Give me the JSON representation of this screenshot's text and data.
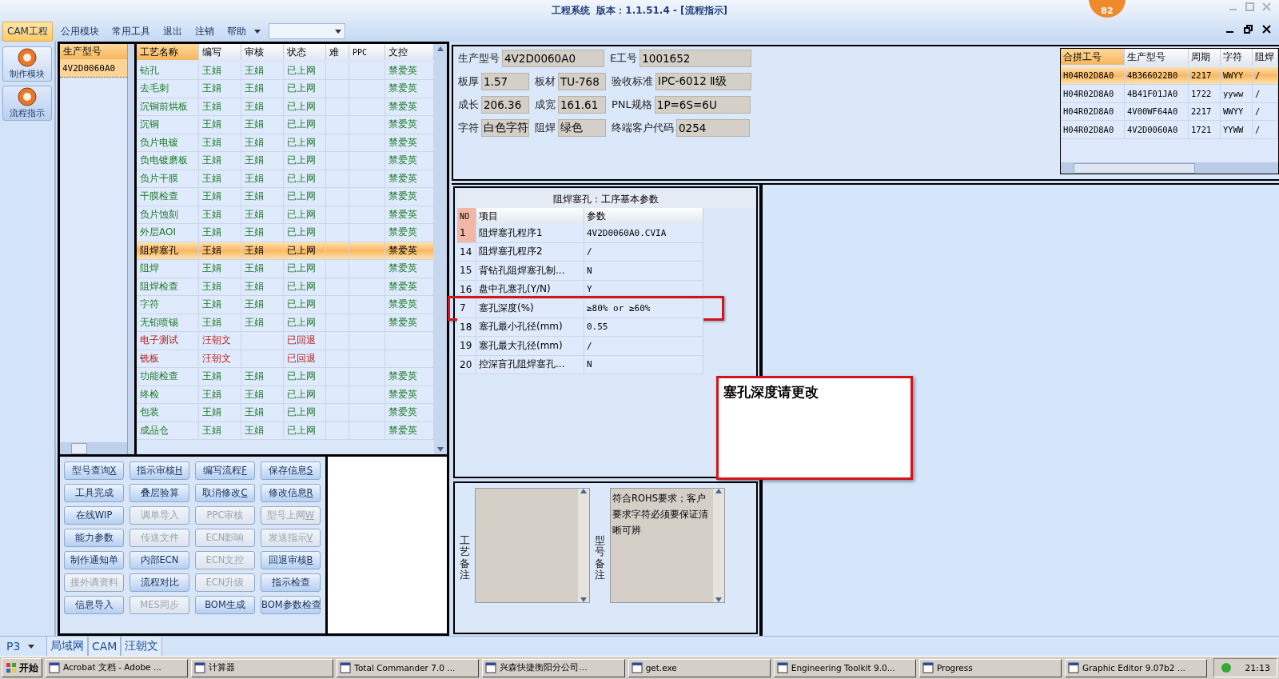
{
  "title_bar": {
    "title": "工程系统  版本：1.1.51.4 - [流程指示]",
    "badge": "82"
  },
  "menu": {
    "items": [
      {
        "label": "CAM工程",
        "selected": true
      },
      {
        "label": "公用模块",
        "selected": false
      },
      {
        "label": "常用工具",
        "selected": false
      },
      {
        "label": "退出",
        "selected": false
      },
      {
        "label": "注销",
        "selected": false
      },
      {
        "label": "帮助",
        "selected": false
      }
    ]
  },
  "nav": [
    {
      "label": "制作模块",
      "selected": false
    },
    {
      "label": "流程指示",
      "selected": true
    }
  ],
  "models": {
    "header": "生产型号",
    "rows": [
      {
        "text": "4V2D0060A0",
        "selected": true
      }
    ]
  },
  "process_table": {
    "columns": [
      "工艺名称",
      "编写",
      "审核",
      "状态",
      "难",
      "PPC",
      "文控"
    ],
    "rows": [
      {
        "cells": [
          "钻孔",
          "王娟",
          "王娟",
          "已上网",
          "",
          "",
          "禁爱英"
        ],
        "kind": "online",
        "selected": false
      },
      {
        "cells": [
          "去毛刺",
          "王娟",
          "王娟",
          "已上网",
          "",
          "",
          "禁爱英"
        ],
        "kind": "online",
        "selected": false
      },
      {
        "cells": [
          "沉铜前烘板",
          "王娟",
          "王娟",
          "已上网",
          "",
          "",
          "禁爱英"
        ],
        "kind": "online",
        "selected": false
      },
      {
        "cells": [
          "沉铜",
          "王娟",
          "王娟",
          "已上网",
          "",
          "",
          "禁爱英"
        ],
        "kind": "online",
        "selected": false
      },
      {
        "cells": [
          "负片电镀",
          "王娟",
          "王娟",
          "已上网",
          "",
          "",
          "禁爱英"
        ],
        "kind": "online",
        "selected": false
      },
      {
        "cells": [
          "负电镀磨板",
          "王娟",
          "王娟",
          "已上网",
          "",
          "",
          "禁爱英"
        ],
        "kind": "online",
        "selected": false
      },
      {
        "cells": [
          "负片干膜",
          "王娟",
          "王娟",
          "已上网",
          "",
          "",
          "禁爱英"
        ],
        "kind": "online",
        "selected": false
      },
      {
        "cells": [
          "干膜检查",
          "王娟",
          "王娟",
          "已上网",
          "",
          "",
          "禁爱英"
        ],
        "kind": "online",
        "selected": false
      },
      {
        "cells": [
          "负片蚀刻",
          "王娟",
          "王娟",
          "已上网",
          "",
          "",
          "禁爱英"
        ],
        "kind": "online",
        "selected": false
      },
      {
        "cells": [
          "外层AOI",
          "王娟",
          "王娟",
          "已上网",
          "",
          "",
          "禁爱英"
        ],
        "kind": "online",
        "selected": false
      },
      {
        "cells": [
          "阻焊塞孔",
          "王娟",
          "王娟",
          "已上网",
          "",
          "",
          "禁爱英"
        ],
        "kind": "online",
        "selected": true
      },
      {
        "cells": [
          "阻焊",
          "王娟",
          "王娟",
          "已上网",
          "",
          "",
          "禁爱英"
        ],
        "kind": "online",
        "selected": false
      },
      {
        "cells": [
          "阻焊检查",
          "王娟",
          "王娟",
          "已上网",
          "",
          "",
          "禁爱英"
        ],
        "kind": "online",
        "selected": false
      },
      {
        "cells": [
          "字符",
          "王娟",
          "王娟",
          "已上网",
          "",
          "",
          "禁爱英"
        ],
        "kind": "online",
        "selected": false
      },
      {
        "cells": [
          "无铅喷锡",
          "王娟",
          "王娟",
          "已上网",
          "",
          "",
          "禁爱英"
        ],
        "kind": "online",
        "selected": false
      },
      {
        "cells": [
          "电子测试",
          "汪朝文",
          "",
          "已回退",
          "",
          "",
          ""
        ],
        "kind": "returned",
        "selected": false
      },
      {
        "cells": [
          "铣板",
          "汪朝文",
          "",
          "已回退",
          "",
          "",
          ""
        ],
        "kind": "returned",
        "selected": false
      },
      {
        "cells": [
          "功能检查",
          "王娟",
          "王娟",
          "已上网",
          "",
          "",
          "禁爱英"
        ],
        "kind": "online",
        "selected": false
      },
      {
        "cells": [
          "终检",
          "王娟",
          "王娟",
          "已上网",
          "",
          "",
          "禁爱英"
        ],
        "kind": "online",
        "selected": false
      },
      {
        "cells": [
          "包装",
          "王娟",
          "王娟",
          "已上网",
          "",
          "",
          "禁爱英"
        ],
        "kind": "online",
        "selected": false
      },
      {
        "cells": [
          "成品仓",
          "王娟",
          "王娟",
          "已上网",
          "",
          "",
          "禁爱英"
        ],
        "kind": "online",
        "selected": false
      }
    ]
  },
  "actions": [
    {
      "label": "型号查询",
      "hotkey": "X",
      "disabled": false
    },
    {
      "label": "指示审核",
      "hotkey": "H",
      "disabled": false
    },
    {
      "label": "编写流程",
      "hotkey": "F",
      "disabled": false
    },
    {
      "label": "保存信息",
      "hotkey": "S",
      "disabled": false
    },
    {
      "label": "工具完成",
      "disabled": false
    },
    {
      "label": "叠层验算",
      "disabled": false
    },
    {
      "label": "取消修改",
      "hotkey": "C",
      "disabled": false
    },
    {
      "label": "修改信息",
      "hotkey": "R",
      "disabled": false
    },
    {
      "label": "在线WIP",
      "disabled": false
    },
    {
      "label": "调单导入",
      "disabled": true
    },
    {
      "label": "PPC审核",
      "disabled": true
    },
    {
      "label": "型号上网",
      "hotkey": "W",
      "disabled": true
    },
    {
      "label": "能力参数",
      "disabled": false
    },
    {
      "label": "传送文件",
      "disabled": true
    },
    {
      "label": "ECN影响",
      "disabled": true
    },
    {
      "label": "发送指示",
      "hotkey": "V",
      "disabled": true
    },
    {
      "label": "制作通知单",
      "disabled": false
    },
    {
      "label": "内部ECN",
      "disabled": false
    },
    {
      "label": "ECN文控",
      "disabled": true
    },
    {
      "label": "回退审核",
      "hotkey": "B",
      "disabled": false
    },
    {
      "label": "接外调资料",
      "disabled": true
    },
    {
      "label": "流程对比",
      "disabled": false
    },
    {
      "label": "ECN升级",
      "disabled": true
    },
    {
      "label": "指示检查",
      "disabled": false
    },
    {
      "label": "信息导入",
      "disabled": false
    },
    {
      "label": "MES同步",
      "disabled": true
    },
    {
      "label": "BOM生成",
      "disabled": false
    },
    {
      "label": "BOM参数检查",
      "disabled": false
    }
  ],
  "info": [
    [
      {
        "label": "生产型号",
        "value": "4V2D0060A0"
      },
      {
        "label": "E工号",
        "value": "1001652"
      }
    ],
    [
      {
        "label": "板厚",
        "value": "1.57"
      },
      {
        "label": "板材",
        "value": "TU-768"
      },
      {
        "label": "验收标准",
        "value": "IPC-6012 Ⅱ级"
      }
    ],
    [
      {
        "label": "成长",
        "value": "206.36"
      },
      {
        "label": "成宽",
        "value": "161.61"
      },
      {
        "label": "PNL规格",
        "value": "1P=6S=6U"
      }
    ],
    [
      {
        "label": "字符",
        "value": "白色字符"
      },
      {
        "label": "阻焊",
        "value": "绿色"
      },
      {
        "label": "终端客户代码",
        "value": "0254"
      }
    ]
  ],
  "merge_table": {
    "columns": [
      "合拼工号",
      "生产型号",
      "周期",
      "字符",
      "阻焊"
    ],
    "rows": [
      {
        "cells": [
          "H04R02D8A0",
          "4B366022B0",
          "2217",
          "WWYY",
          "/"
        ],
        "selected": true
      },
      {
        "cells": [
          "H04R02D8A0",
          "4B41F01JA0",
          "1722",
          "yyww",
          "/"
        ],
        "selected": false
      },
      {
        "cells": [
          "H04R02D8A0",
          "4V00WF64A0",
          "2217",
          "WWYY",
          "/"
        ],
        "selected": false
      },
      {
        "cells": [
          "H04R02D8A0",
          "4V2D0060A0",
          "1721",
          "YYWW",
          "/"
        ],
        "selected": false
      }
    ]
  },
  "params": {
    "title": "阻焊塞孔：工序基本参数",
    "columns": [
      "NO",
      "项目",
      "参数"
    ],
    "rows": [
      {
        "no": "1",
        "item": "阻焊塞孔程序1",
        "value": "4V2D0060A0.CVIA",
        "selected": true,
        "highlighted": false
      },
      {
        "no": "14",
        "item": "阻焊塞孔程序2",
        "value": "/",
        "selected": false,
        "highlighted": false
      },
      {
        "no": "15",
        "item": "背钻孔阻焊塞孔制...",
        "value": "N",
        "selected": false,
        "highlighted": false
      },
      {
        "no": "16",
        "item": "盘中孔塞孔(Y/N)",
        "value": "Y",
        "selected": false,
        "highlighted": false
      },
      {
        "no": "7",
        "item": "塞孔深度(%)",
        "value": "≥80% or ≥60%",
        "selected": false,
        "highlighted": true
      },
      {
        "no": "18",
        "item": "塞孔最小孔径(mm)",
        "value": "0.55",
        "selected": false,
        "highlighted": false
      },
      {
        "no": "19",
        "item": "塞孔最大孔径(mm)",
        "value": "/",
        "selected": false,
        "highlighted": false
      },
      {
        "no": "20",
        "item": "控深盲孔阻焊塞孔...",
        "value": "N",
        "selected": false,
        "highlighted": false
      }
    ]
  },
  "note": "塞孔深度请更改",
  "remarks": [
    {
      "label": "工艺备注"
    },
    {
      "label": "型号备注",
      "value": "符合ROHS要求；客户要求字符必须要保证清晰可辨"
    }
  ],
  "status_tabs": {
    "dropdown": "P3",
    "tabs": [
      "局域网",
      "CAM",
      "汪朝文"
    ]
  },
  "taskbar": {
    "start": "开始",
    "tasks": [
      "Acrobat 文档 - Adobe ...",
      "计算器",
      "Total Commander 7.0 ...",
      "兴森快捷衡阳分公司...",
      "get.exe",
      "Engineering Toolkit 9.0...",
      "Progress",
      "Graphic Editor 9.07b2 ..."
    ],
    "clock": "21:13"
  }
}
